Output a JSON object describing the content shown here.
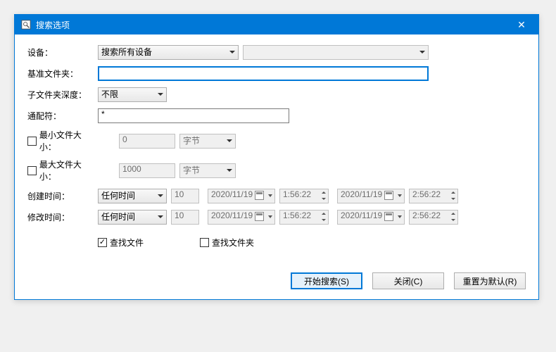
{
  "title": "搜索选项",
  "labels": {
    "device": "设备：",
    "baseFolder": "基准文件夹：",
    "subfolderDepth": "子文件夹深度：",
    "wildcard": "通配符：",
    "minFileSize": "最小文件大小：",
    "maxFileSize": "最大文件大小：",
    "createTime": "创建时间：",
    "modifyTime": "修改时间：",
    "findFiles": "查找文件",
    "findFolders": "查找文件夹"
  },
  "values": {
    "device": "搜索所有设备",
    "device2": "",
    "baseFolder": "",
    "subfolderDepth": "不限",
    "wildcard": "*",
    "minSize": "0",
    "minUnit": "字节",
    "maxSize": "1000",
    "maxUnit": "字节",
    "createMode": "任何时间",
    "createN": "10",
    "createDate1": "2020/11/19",
    "createTime1": "1:56:22",
    "createDate2": "2020/11/19",
    "createTime2": "2:56:22",
    "modifyMode": "任何时间",
    "modifyN": "10",
    "modifyDate1": "2020/11/19",
    "modifyTime1": "1:56:22",
    "modifyDate2": "2020/11/19",
    "modifyTime2": "2:56:22"
  },
  "checks": {
    "minSize": false,
    "maxSize": false,
    "findFiles": true,
    "findFolders": false
  },
  "buttons": {
    "start": "开始搜索(S)",
    "close": "关闭(C)",
    "reset": "重置为默认(R)"
  }
}
